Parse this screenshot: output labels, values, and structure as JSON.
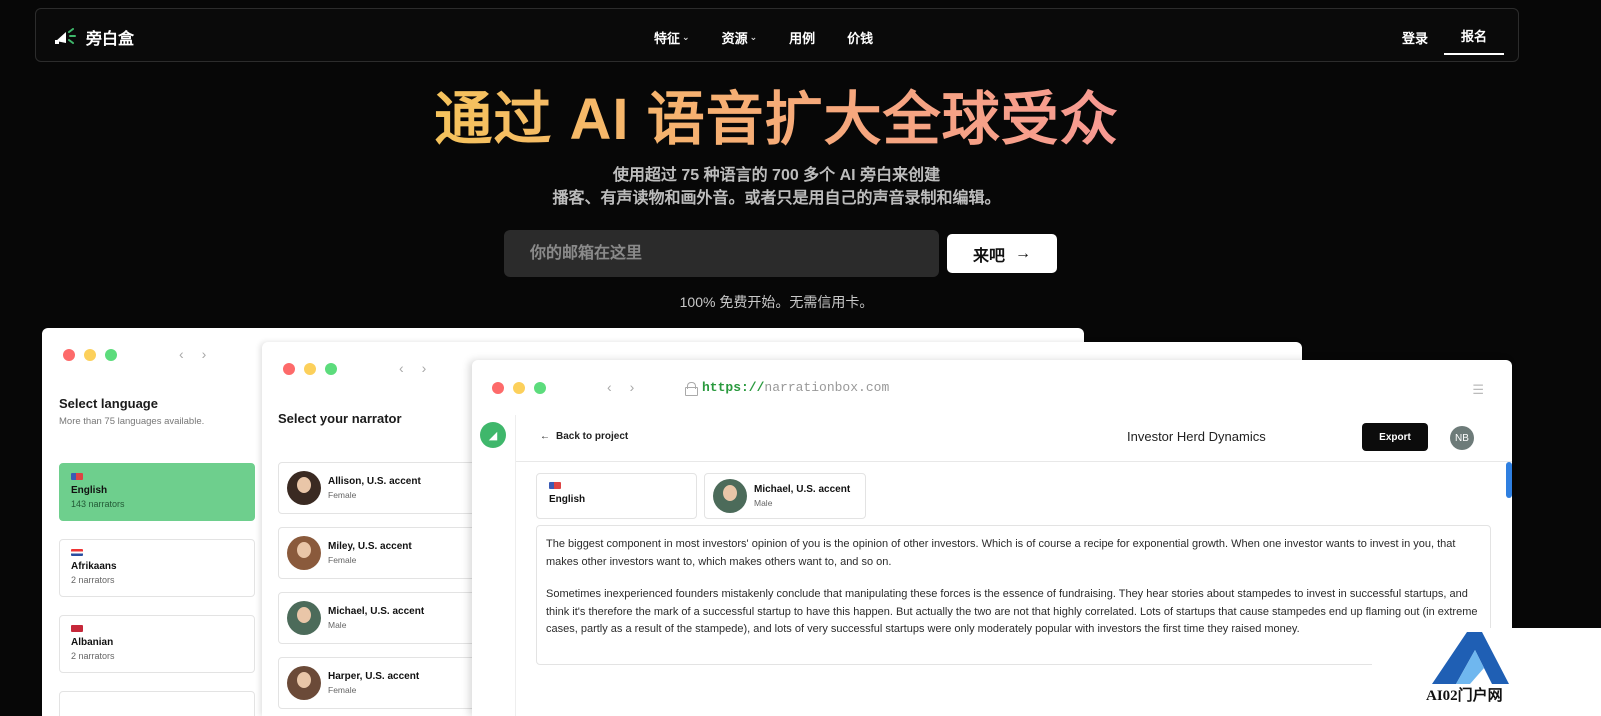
{
  "nav": {
    "brand": "旁白盒",
    "links": [
      {
        "label": "特征",
        "dropdown": true
      },
      {
        "label": "资源",
        "dropdown": true
      },
      {
        "label": "用例",
        "dropdown": false
      },
      {
        "label": "价钱",
        "dropdown": false
      }
    ],
    "login": "登录",
    "signup": "报名"
  },
  "hero": {
    "title": "通过 AI 语音扩大全球受众",
    "subtitle_line1": "使用超过 75 种语言的 700 多个 AI 旁白来创建",
    "subtitle_line2": "播客、有声读物和画外音。或者只是用自己的声音录制和编辑。",
    "email_placeholder": "你的邮箱在这里",
    "cta_label": "来吧",
    "note": "100% 免费开始。无需信用卡。"
  },
  "window_language": {
    "title": "Select language",
    "subtitle": "More than 75 languages available.",
    "languages": [
      {
        "name": "English",
        "count": "143 narrators",
        "selected": true
      },
      {
        "name": "Afrikaans",
        "count": "2 narrators",
        "selected": false
      },
      {
        "name": "Albanian",
        "count": "2 narrators",
        "selected": false
      }
    ]
  },
  "window_narrator": {
    "title": "Select your narrator",
    "narrators": [
      {
        "name": "Allison, U.S. accent",
        "gender": "Female"
      },
      {
        "name": "Miley, U.S. accent",
        "gender": "Female"
      },
      {
        "name": "Michael, U.S. accent",
        "gender": "Male"
      },
      {
        "name": "Harper, U.S. accent",
        "gender": "Female"
      }
    ]
  },
  "window_editor": {
    "url_scheme": "https://",
    "url_host": "narrationbox.com",
    "back_label": "Back to project",
    "project_title": "Investor Herd Dynamics",
    "export_label": "Export",
    "user_initials": "NB",
    "selected_language": "English",
    "selected_narrator": {
      "name": "Michael, U.S. accent",
      "gender": "Male"
    },
    "paragraph1": "The biggest component in most investors' opinion of you is the opinion of other investors. Which is of course a recipe for exponential growth. When one investor wants to invest in you, that makes other investors want to, which makes others want to, and so on.",
    "paragraph2": "Sometimes inexperienced founders mistakenly conclude that manipulating these forces is the essence of fundraising. They hear stories about stampedes to invest in successful startups, and think it's therefore the mark of a successful startup to have this happen. But actually the two are not that highly correlated. Lots of startups that cause stampedes end up flaming out (in extreme cases, partly as a result of the stampede), and lots of very successful startups were only moderately popular with investors the first time they raised money."
  },
  "watermark": {
    "text": "AI02门户网"
  },
  "colors": {
    "accent_green": "#6ecf8d",
    "title_gradient_start": "#f5c35c",
    "title_gradient_end": "#f79a93",
    "background": "#070707"
  }
}
